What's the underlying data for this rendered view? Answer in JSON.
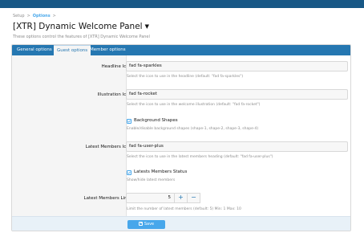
{
  "breadcrumb": {
    "setup": "Setup",
    "sep": ">",
    "options": "Options"
  },
  "page": {
    "title": "[XTR] Dynamic Welcome Panel",
    "description": "These options control the features of [XTR] Dynamic Welcome Panel"
  },
  "tabs": [
    {
      "label": "General options",
      "active": false
    },
    {
      "label": "Guest options",
      "active": true
    },
    {
      "label": "Member options",
      "active": false
    }
  ],
  "fields": {
    "headline_icon": {
      "label": "Headline Icon:",
      "value": "fad fa-sparkles",
      "hint": "Select the icon to use in the headline (default: \"fad fa-sparkles\")"
    },
    "illustration_icon": {
      "label": "Illustration Icon:",
      "value": "fad fa-rocket",
      "hint": "Select the icon to use in the welcome illustration (default: \"fad fa-rocket\")"
    },
    "background_shapes": {
      "label": "Background Shapes",
      "checked": true,
      "hint": "Enable/disable background shapes (shape-1, shape-2, shape-3, shape-4)"
    },
    "latest_members_icon": {
      "label": "Latest Members Icon:",
      "value": "fad fa-user-plus",
      "hint": "Select the icon to use in the latest members heading (default: \"fad fa-user-plus\")"
    },
    "latest_members_status": {
      "label": "Latests Members Status",
      "checked": true,
      "hint": "Show/hide latest members"
    },
    "latest_members_limit": {
      "label": "Latest Members Limit:",
      "value": "5",
      "plus": "+",
      "minus": "−",
      "hint": "Limit the number of latest members (default: 5) Min: 1 Max: 10"
    }
  },
  "footer": {
    "save_label": "Save"
  },
  "colors": {
    "accent": "#47a7eb",
    "tab_bar": "#2577b1",
    "top_bar": "#185886"
  }
}
